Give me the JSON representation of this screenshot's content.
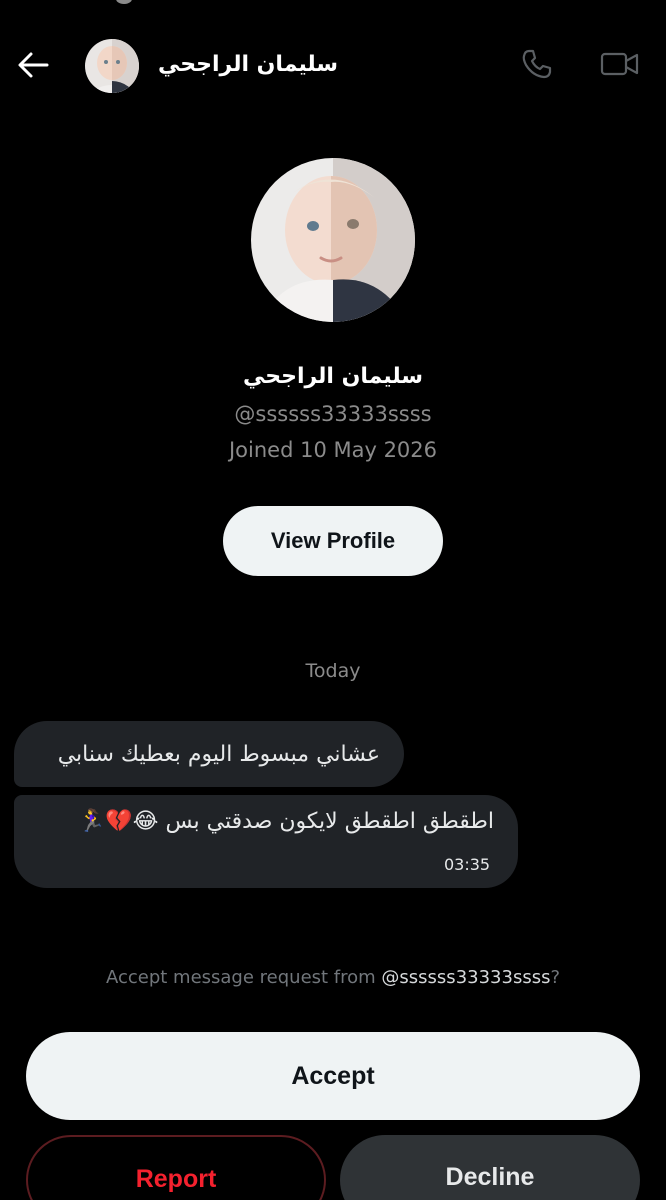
{
  "header": {
    "name": "سليمان الراجحي",
    "back_icon": "arrow-left-icon",
    "call_icon": "phone-icon",
    "video_icon": "video-camera-icon"
  },
  "profile": {
    "name": "سليمان الراجحي",
    "handle": "@ssssss33333ssss",
    "joined": "Joined 10 May 2026",
    "view_profile_label": "View Profile"
  },
  "conversation": {
    "date_separator": "Today",
    "messages": [
      {
        "text": "عشاني مبسوط اليوم بعطيك سنابي"
      },
      {
        "text": "اطقطق اطقطق لايكون صدقتي بس 😂💔🏃‍♀️",
        "time": "03:35"
      }
    ]
  },
  "request": {
    "prefix": "Accept message request from ",
    "handle": "@ssssss33333ssss",
    "suffix": "?",
    "accept_label": "Accept",
    "report_label": "Report",
    "decline_label": "Decline"
  },
  "colors": {
    "background": "#000000",
    "bubble": "#202327",
    "button_light": "#eff3f4",
    "danger": "#f4212e",
    "muted_text": "#8b8b8b"
  }
}
